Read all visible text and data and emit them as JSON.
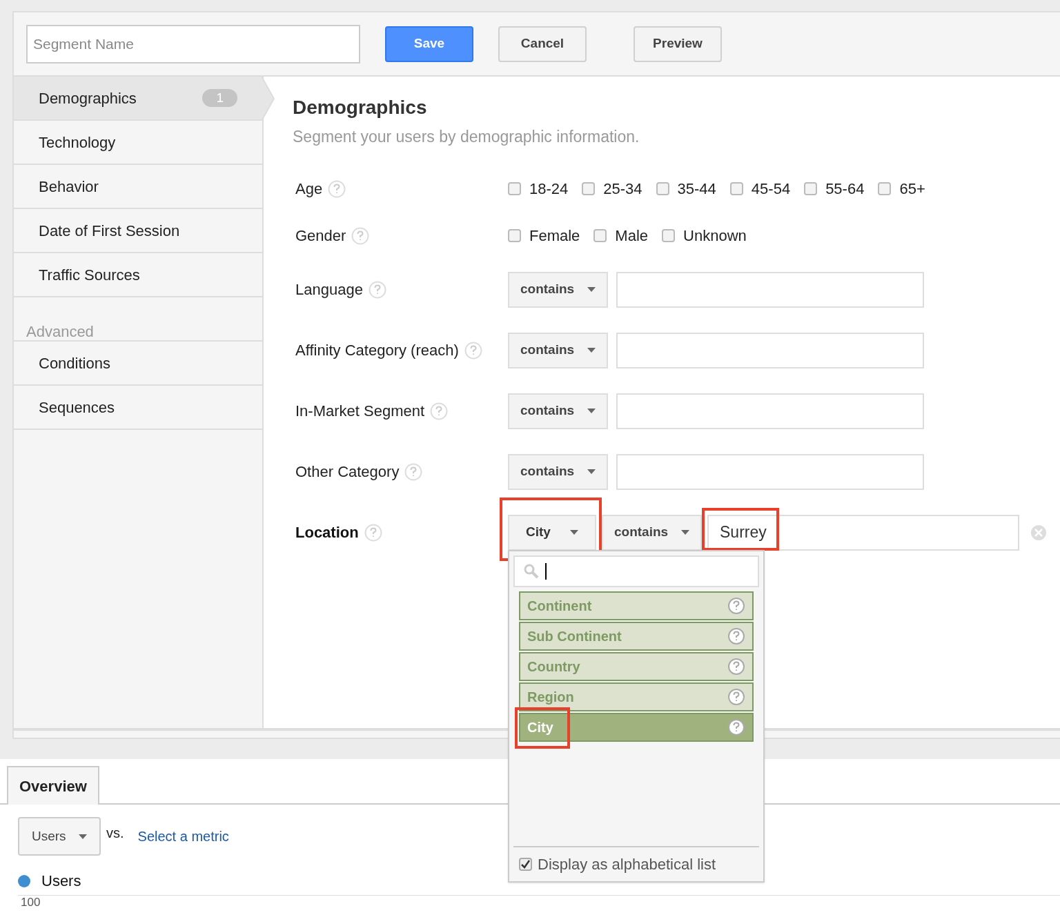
{
  "header": {
    "segment_name_placeholder": "Segment Name",
    "buttons": [
      {
        "label": "Save",
        "kind": "primary"
      },
      {
        "label": "Cancel",
        "kind": "default"
      },
      {
        "label": "Preview",
        "kind": "default"
      }
    ]
  },
  "sidebar": {
    "items": [
      {
        "label": "Demographics",
        "badge": "1",
        "selected": true
      },
      {
        "label": "Technology",
        "selected": false
      },
      {
        "label": "Behavior",
        "selected": false
      },
      {
        "label": "Date of First Session",
        "selected": false
      },
      {
        "label": "Traffic Sources",
        "selected": false
      }
    ],
    "section_label": "Advanced",
    "advanced_items": [
      {
        "label": "Conditions",
        "selected": false
      },
      {
        "label": "Sequences",
        "selected": false
      }
    ]
  },
  "content": {
    "title": "Demographics",
    "subtitle": "Segment your users by demographic information.",
    "rows": [
      {
        "kind": "checkboxes",
        "label": "Age",
        "options": [
          {
            "label": "18-24",
            "checked": false
          },
          {
            "label": "25-34",
            "checked": false
          },
          {
            "label": "35-44",
            "checked": false
          },
          {
            "label": "45-54",
            "checked": false
          },
          {
            "label": "55-64",
            "checked": false
          },
          {
            "label": "65+",
            "checked": false
          }
        ]
      },
      {
        "kind": "checkboxes",
        "label": "Gender",
        "options": [
          {
            "label": "Female",
            "checked": false
          },
          {
            "label": "Male",
            "checked": false
          },
          {
            "label": "Unknown",
            "checked": false
          }
        ]
      },
      {
        "kind": "filter",
        "label": "Language",
        "operator": "contains"
      },
      {
        "kind": "filter",
        "label": "Affinity Category (reach)",
        "operator": "contains"
      },
      {
        "kind": "filter",
        "label": "In-Market Segment",
        "operator": "contains"
      },
      {
        "kind": "filter",
        "label": "Other Category",
        "operator": "contains"
      }
    ],
    "location": {
      "label": "Location",
      "dimension": "City",
      "dimension_highlighted": true,
      "operator": "contains",
      "value": "Surrey",
      "value_highlighted": true,
      "dropdown": {
        "options": [
          {
            "label": "Continent",
            "selected": false,
            "highlighted": false
          },
          {
            "label": "Sub Continent",
            "selected": false,
            "highlighted": false
          },
          {
            "label": "Country",
            "selected": false,
            "highlighted": false
          },
          {
            "label": "Region",
            "selected": false,
            "highlighted": false
          },
          {
            "label": "City",
            "selected": true,
            "highlighted": true
          }
        ],
        "alphabetical": {
          "label": "Display as alphabetical list",
          "checked": true
        }
      }
    }
  },
  "overview": {
    "tab": "Overview",
    "metric": "Users",
    "vs": "vs.",
    "select_metric": "Select a metric",
    "legend": {
      "label": "Users",
      "color": "#3d8fd0"
    },
    "axis_label": "100"
  }
}
